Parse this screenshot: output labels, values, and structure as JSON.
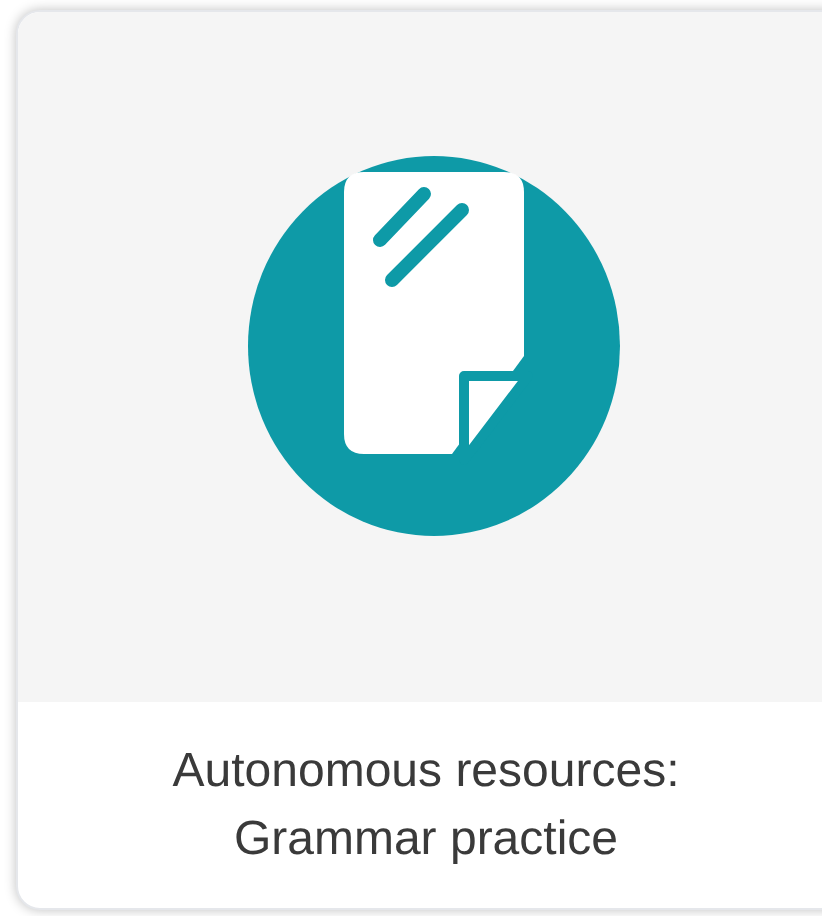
{
  "card": {
    "title": "Autonomous resources: Grammar practice"
  }
}
